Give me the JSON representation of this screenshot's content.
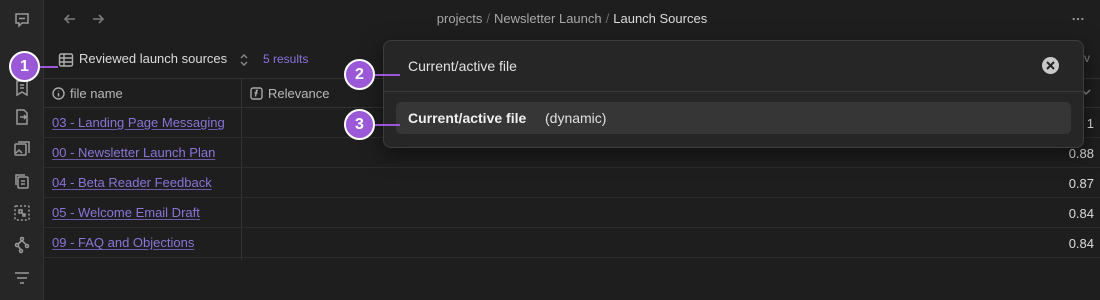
{
  "breadcrumb": {
    "items": [
      "projects",
      "Newsletter Launch"
    ],
    "current": "Launch Sources",
    "separator": "/"
  },
  "view": {
    "name": "Reviewed launch sources",
    "results": "5 results"
  },
  "table": {
    "columns": [
      "file name",
      "Relevance"
    ],
    "rows": [
      {
        "file": "03 - Landing Page Messaging",
        "score": "1"
      },
      {
        "file": "00 - Newsletter Launch Plan",
        "score": "0.88"
      },
      {
        "file": "04 - Beta Reader Feedback",
        "score": "0.87"
      },
      {
        "file": "05 - Welcome Email Draft",
        "score": "0.84"
      },
      {
        "file": "09 - FAQ and Objections",
        "score": "0.84"
      }
    ]
  },
  "popup": {
    "query": "Current/active file",
    "suggestion_main": "Current/active file",
    "suggestion_sub": "(dynamic)"
  },
  "edge": {
    "letter": "v"
  },
  "callouts": [
    "1",
    "2",
    "3"
  ],
  "colors": {
    "accent": "#8b74da",
    "callout": "#9b59d8",
    "background": "#1e1e1e"
  },
  "icons": {
    "ribbon": [
      "chat-icon",
      "bookmark-icon",
      "file-export-icon",
      "image-icon",
      "copy-icon",
      "canvas-icon",
      "graph-icon",
      "filter-icon"
    ]
  }
}
